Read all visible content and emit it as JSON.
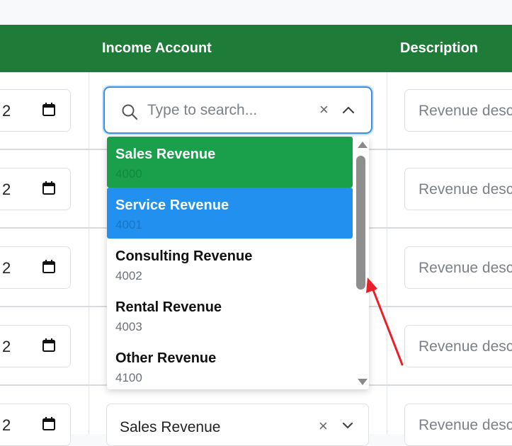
{
  "header": {
    "income_account": "Income Account",
    "description": "Description"
  },
  "rows": [
    {
      "date_partial": "2",
      "description_placeholder": "Revenue descr"
    },
    {
      "date_partial": "2",
      "description_placeholder": "Revenue descr"
    },
    {
      "date_partial": "2",
      "description_placeholder": "Revenue descr"
    },
    {
      "date_partial": "2",
      "description_placeholder": "Revenue descr"
    },
    {
      "date_partial": "2",
      "description_placeholder": "Revenue descr"
    }
  ],
  "search": {
    "placeholder": "Type to search...",
    "clear_symbol": "×"
  },
  "dropdown": {
    "options": [
      {
        "name": "Sales Revenue",
        "code": "4000",
        "state": "selected"
      },
      {
        "name": "Service Revenue",
        "code": "4001",
        "state": "hover"
      },
      {
        "name": "Consulting Revenue",
        "code": "4002",
        "state": "normal"
      },
      {
        "name": "Rental Revenue",
        "code": "4003",
        "state": "normal"
      },
      {
        "name": "Other Revenue",
        "code": "4100",
        "state": "normal"
      }
    ]
  },
  "select_row5": {
    "value": "Sales Revenue",
    "clear_symbol": "×"
  },
  "colors": {
    "header_bg": "#1e7b38",
    "selected_bg": "#1aa04a",
    "hover_bg": "#2290ee",
    "focus_border": "#3d8fe0",
    "annotation_arrow": "#e8202a"
  }
}
